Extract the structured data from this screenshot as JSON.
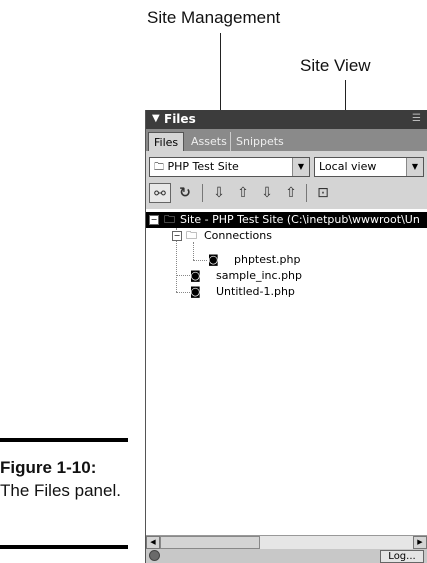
{
  "callouts": {
    "site_management": "Site Management",
    "site_view": "Site View"
  },
  "figure": {
    "number": "Figure 1-10:",
    "caption": "The Files panel."
  },
  "panel": {
    "title": "Files",
    "tabs": [
      {
        "label": "Files",
        "active": true
      },
      {
        "label": "Assets",
        "active": false
      },
      {
        "label": "Snippets",
        "active": false
      }
    ],
    "site_select": "PHP Test Site",
    "view_select": "Local view",
    "toolbar": [
      "connect-icon",
      "refresh-icon",
      "get-files-icon",
      "put-files-icon",
      "check-out-icon",
      "check-in-icon",
      "expand-icon"
    ],
    "tree": {
      "root": "Site - PHP Test Site (C:\\inetpub\\wwwroot\\Un",
      "items": [
        {
          "label": "Connections",
          "type": "folder",
          "depth": 1
        },
        {
          "label": "phptest.php",
          "type": "file",
          "depth": 2
        },
        {
          "label": "sample_inc.php",
          "type": "file",
          "depth": 1
        },
        {
          "label": "Untitled-1.php",
          "type": "file",
          "depth": 1
        }
      ]
    },
    "log_button": "Log..."
  }
}
